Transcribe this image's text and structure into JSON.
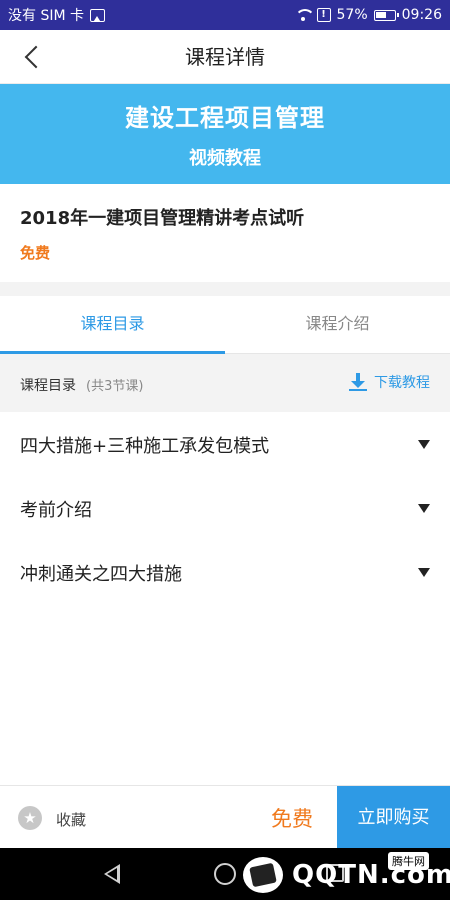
{
  "status_bar": {
    "sim": "没有 SIM 卡",
    "battery": "57%",
    "time": "09:26"
  },
  "header": {
    "title": "课程详情"
  },
  "banner": {
    "title": "建设工程项目管理",
    "subtitle": "视频教程"
  },
  "course": {
    "name": "2018年一建项目管理精讲考点试听",
    "price": "免费"
  },
  "tabs": [
    {
      "label": "课程目录",
      "active": true
    },
    {
      "label": "课程介绍",
      "active": false
    }
  ],
  "toc": {
    "label": "课程目录",
    "count": "(共3节课)",
    "download_label": "下载教程"
  },
  "lessons": [
    {
      "title": "四大措施+三种施工承发包模式"
    },
    {
      "title": "考前介绍"
    },
    {
      "title": "冲刺通关之四大措施"
    }
  ],
  "bottom_bar": {
    "favorite_label": "收藏",
    "price": "免费",
    "buy_label": "立即购买"
  },
  "watermark": {
    "text": "QQTN.com",
    "badge": "腾牛网"
  },
  "colors": {
    "accent": "#2e9ae5",
    "banner": "#44b7ee",
    "price": "#f07a1e",
    "status_bar": "#2f2f9a"
  }
}
